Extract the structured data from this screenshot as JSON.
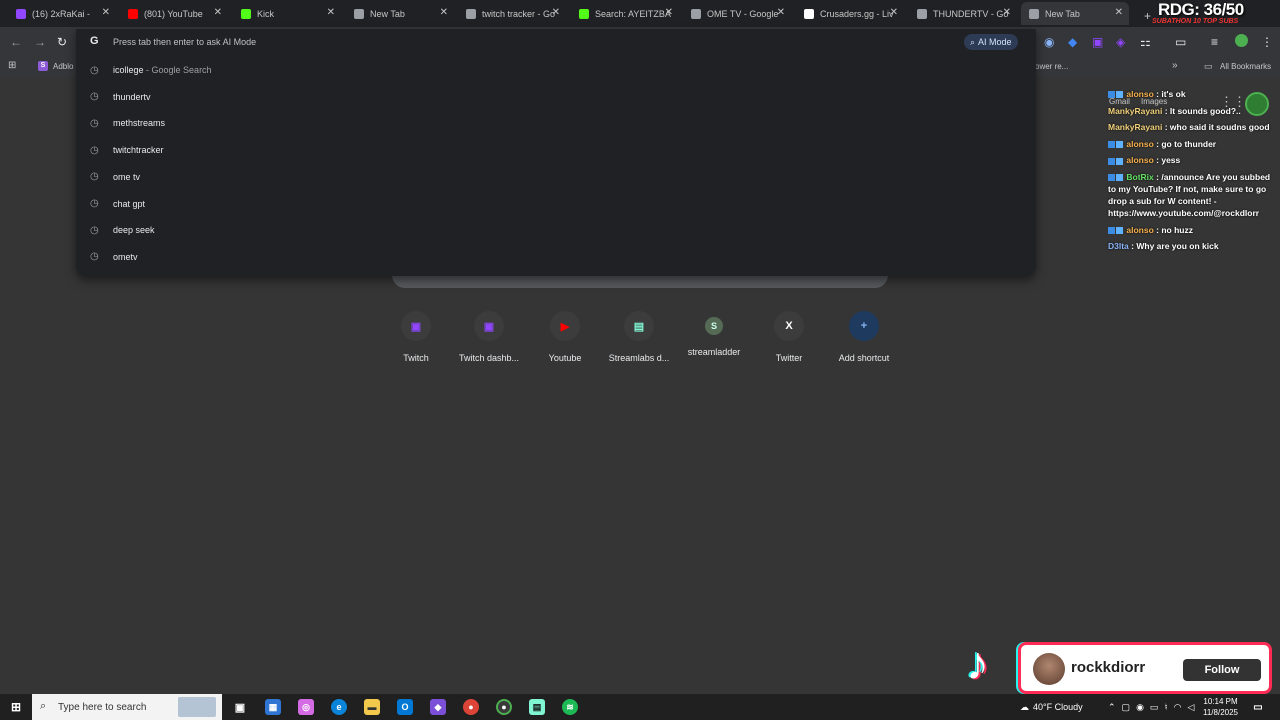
{
  "tabs": [
    {
      "title": "(16) 2xRaKai -",
      "fav_color": "#9146ff"
    },
    {
      "title": "(801) YouTube",
      "fav_color": "#ff0000"
    },
    {
      "title": "Kick",
      "fav_color": "#53fc18"
    },
    {
      "title": "New Tab",
      "fav_color": "#9aa0a6"
    },
    {
      "title": "twitch tracker - Go",
      "fav_color": "#9aa0a6"
    },
    {
      "title": "Search: AYEITZBA",
      "fav_color": "#53fc18"
    },
    {
      "title": "OME TV - Google",
      "fav_color": "#9aa0a6"
    },
    {
      "title": "Crusaders.gg - Liv",
      "fav_color": "#ffffff"
    },
    {
      "title": "THUNDERTV - Go",
      "fav_color": "#9aa0a6"
    },
    {
      "title": "New Tab",
      "fav_color": "#9aa0a6"
    }
  ],
  "omnibox": {
    "placeholder": "Press tab then enter to ask AI Mode",
    "ai_mode_label": "AI Mode",
    "suggestions": [
      {
        "text": "icollege",
        "sub": " - Google Search"
      },
      {
        "text": "thundertv",
        "sub": ""
      },
      {
        "text": "methstreams",
        "sub": ""
      },
      {
        "text": "twitchtracker",
        "sub": ""
      },
      {
        "text": "ome tv",
        "sub": ""
      },
      {
        "text": "chat gpt",
        "sub": ""
      },
      {
        "text": "deep seek",
        "sub": ""
      },
      {
        "text": "ometv",
        "sub": ""
      }
    ]
  },
  "bookmarks": {
    "first": "Adblo",
    "partial": "ower re...",
    "all": "All Bookmarks"
  },
  "google_links": {
    "gmail": "Gmail",
    "images": "Images"
  },
  "shortcuts": [
    {
      "label": "Twitch",
      "glyph": "▣",
      "color": "#9146ff"
    },
    {
      "label": "Twitch dashb...",
      "glyph": "▣",
      "color": "#9146ff"
    },
    {
      "label": "Youtube",
      "glyph": "▶",
      "color": "#ff0000"
    },
    {
      "label": "Streamlabs d...",
      "glyph": "▤",
      "color": "#80f5d2"
    },
    {
      "label": "streamladder",
      "glyph": "S",
      "color": "#4caf50"
    },
    {
      "label": "Twitter",
      "glyph": "X",
      "color": "#ffffff"
    },
    {
      "label": "Add shortcut",
      "glyph": "+",
      "color": "#8ab4f8"
    }
  ],
  "overlay": {
    "rdg": "RDG: 36/50",
    "rdg_sub": "SUBATHON 10 TOP SUBS"
  },
  "chat": [
    {
      "user": "alonso",
      "text": "it's ok",
      "cls": "n1",
      "badge": true
    },
    {
      "user": "MankyRayani",
      "text": "It sounds good?..",
      "cls": "n2",
      "badge": false
    },
    {
      "user": "MankyRayani",
      "text": "who said it soudns good",
      "cls": "n2",
      "badge": false
    },
    {
      "user": "alonso",
      "text": "go to thunder",
      "cls": "n1",
      "badge": true
    },
    {
      "user": "alonso",
      "text": "yess",
      "cls": "n1",
      "badge": true
    },
    {
      "user": "BotRix",
      "text": "/announce Are you subbed to my YouTube? If not, make sure to go drop a sub for W content! - https://www.youtube.com/@rockdlorr",
      "cls": "n3",
      "badge": true
    },
    {
      "user": "alonso",
      "text": "no huzz",
      "cls": "n1",
      "badge": true
    },
    {
      "user": "D3lta",
      "text": "Why are you on kick",
      "cls": "n4",
      "badge": false
    }
  ],
  "follow_card": {
    "username": "rockkdiorr",
    "button": "Follow"
  },
  "taskbar": {
    "search_placeholder": "Type here to search",
    "weather": "40°F  Cloudy",
    "time": "10:14 PM",
    "date": "11/8/2025"
  }
}
